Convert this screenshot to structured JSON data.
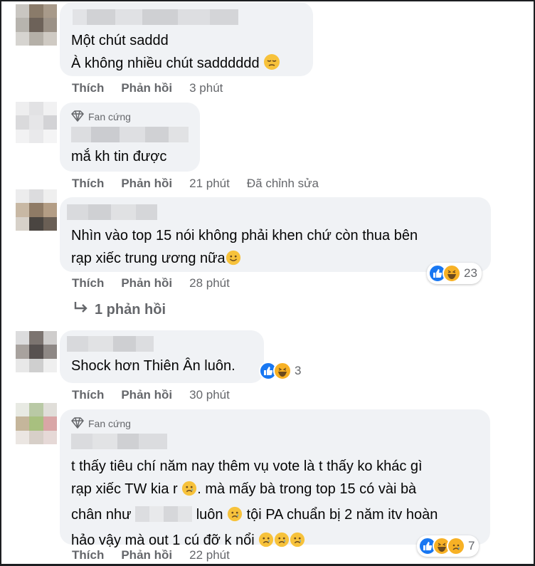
{
  "comments": [
    {
      "lines": [
        "Một chút saddd",
        "À không nhiều chút sadddddd"
      ],
      "actions": {
        "like": "Thích",
        "reply": "Phản hồi",
        "time": "3 phút"
      }
    },
    {
      "badge": "Fan cứng",
      "lines": [
        "mắ kh tin được"
      ],
      "actions": {
        "like": "Thích",
        "reply": "Phản hồi",
        "time": "21 phút",
        "edited": "Đã chỉnh sửa"
      }
    },
    {
      "lines": [
        "Nhìn vào top 15 nói không phải khen chứ còn thua bên",
        "rạp xiếc trung ương nữa"
      ],
      "reactions": {
        "types": [
          "like-icon",
          "haha-icon"
        ],
        "count": "23"
      },
      "actions": {
        "like": "Thích",
        "reply": "Phản hồi",
        "time": "28 phút"
      },
      "replies": "1 phản hồi"
    },
    {
      "lines": [
        "Shock hơn Thiên Ân luôn."
      ],
      "reactions": {
        "types": [
          "like-icon",
          "haha-icon"
        ],
        "count": "3"
      },
      "actions": {
        "like": "Thích",
        "reply": "Phản hồi",
        "time": "30 phút"
      }
    },
    {
      "badge": "Fan cứng",
      "lines": [
        "t thấy tiêu chí năm nay thêm vụ vote là t thấy ko khác gì",
        "rạp xiếc TW kia r",
        ". mà mấy bà trong top 15 có vài bà",
        "chân như",
        "luôn",
        "tội PA chuẩn bị 2 năm itv hoàn",
        "hảo vậy mà out 1 cú đỡ k nổi"
      ],
      "reactions": {
        "types": [
          "like-icon",
          "haha-icon",
          "sad-icon"
        ],
        "count": "7"
      },
      "actions": {
        "like": "Thích",
        "reply": "Phản hồi",
        "time": "22 phút"
      }
    }
  ]
}
